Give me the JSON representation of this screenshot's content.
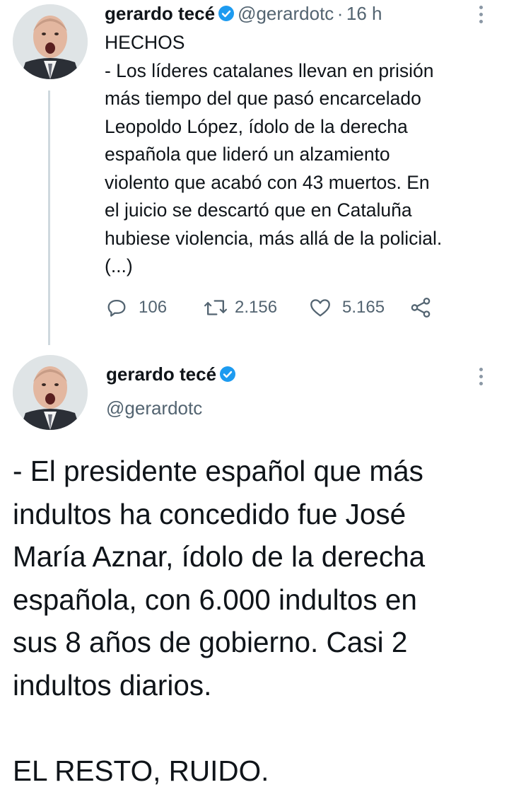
{
  "tweet1": {
    "display_name": "gerardo tecé",
    "handle": "@gerardotc",
    "separator": "·",
    "time": "16 h",
    "text": "HECHOS\n- Los líderes catalanes llevan en prisión\nmás tiempo del que pasó encarcelado\nLeopoldo López, ídolo de la derecha\nespañola que lideró un alzamiento\nviolento que acabó con 43 muertos. En\nel juicio se descartó que en Cataluña\nhubiese violencia, más allá de la policial.\n(...)",
    "replies": "106",
    "retweets": "2.156",
    "likes": "5.165"
  },
  "tweet2": {
    "display_name": "gerardo tecé",
    "handle": "@gerardotc",
    "text": "- El presidente español que más\nindultos ha concedido fue José\nMaría Aznar, ídolo de la derecha\nespañola, con 6.000 indultos en\nsus 8 años de gobierno. Casi 2\nindultos diarios.\n\nEL RESTO, RUIDO."
  },
  "colors": {
    "verified": "#1d9bf0",
    "secondary_text": "#536471",
    "thread_line": "#cfd9de"
  },
  "icons": [
    "verified-badge-icon",
    "more-options-icon",
    "reply-icon",
    "retweet-icon",
    "like-icon",
    "share-icon"
  ]
}
